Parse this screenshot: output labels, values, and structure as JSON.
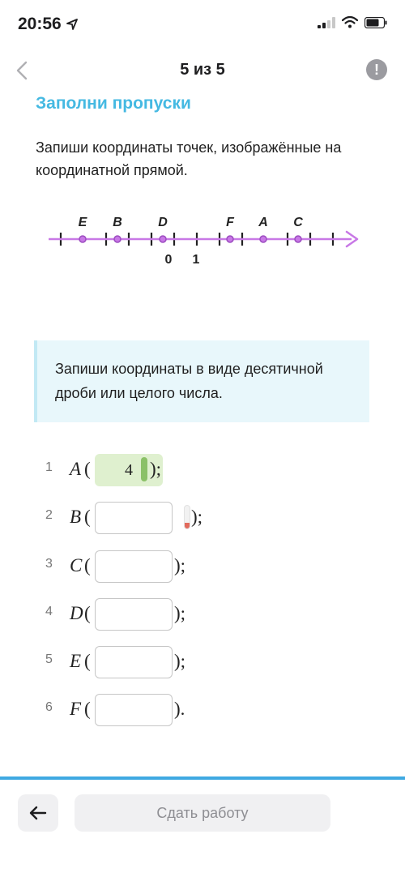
{
  "status_bar": {
    "time": "20:56"
  },
  "nav": {
    "title": "5 из 5",
    "info_icon": "!"
  },
  "section_title": "Заполни пропуски",
  "task": {
    "text": "Запиши координаты точек, изображённые на координатной прямой."
  },
  "number_line": {
    "colors": {
      "line": "#c878e6",
      "point_fill": "#c878e6",
      "point_stroke": "#9c4cc0"
    },
    "tick_labels": [
      "0",
      "1"
    ],
    "points": [
      "E",
      "B",
      "D",
      "F",
      "A",
      "C"
    ]
  },
  "hint": {
    "text": "Запиши координаты в виде десятичной дроби или целого числа."
  },
  "answers": [
    {
      "num": "1",
      "letter": "A",
      "open": "(",
      "value": "4",
      "close": ");"
    },
    {
      "num": "2",
      "letter": "B",
      "open": "(",
      "value": "",
      "close": ");"
    },
    {
      "num": "3",
      "letter": "C",
      "open": "(",
      "value": "",
      "close": ");"
    },
    {
      "num": "4",
      "letter": "D",
      "open": "(",
      "value": "",
      "close": ");"
    },
    {
      "num": "5",
      "letter": "E",
      "open": "(",
      "value": "",
      "close": ");"
    },
    {
      "num": "6",
      "letter": "F",
      "open": "(",
      "value": "",
      "close": ")."
    }
  ],
  "footer": {
    "submit_label": "Сдать работу"
  },
  "icons": {
    "nav_back": "chevron-left-icon",
    "info": "info-icon",
    "bottom_back": "arrow-left-icon"
  }
}
